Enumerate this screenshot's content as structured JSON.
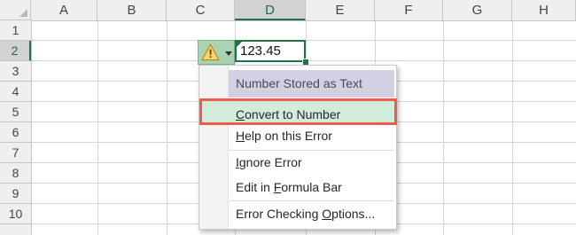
{
  "columns": [
    "A",
    "B",
    "C",
    "D",
    "E",
    "F",
    "G",
    "H"
  ],
  "rows": [
    "1",
    "2",
    "3",
    "4",
    "5",
    "6",
    "7",
    "8",
    "9",
    "10"
  ],
  "selected_column": "D",
  "selected_row": "2",
  "cell": {
    "value": "123.45"
  },
  "error_button": {
    "icon": "warning-icon"
  },
  "menu": {
    "header": "Number Stored as Text",
    "convert": {
      "pre": "",
      "key": "C",
      "post": "onvert to Number"
    },
    "help": {
      "pre": "",
      "key": "H",
      "post": "elp on this Error"
    },
    "ignore": {
      "pre": "",
      "key": "I",
      "post": "gnore Error"
    },
    "edit": {
      "pre": "Edit in ",
      "key": "F",
      "post": "ormula Bar"
    },
    "options": {
      "pre": "Error Checking ",
      "key": "O",
      "post": "ptions..."
    }
  },
  "colors": {
    "accent": "#217346",
    "highlight_border": "#ef5a4f",
    "highlight_fill": "#d2ecdc",
    "header_fill": "#d2d0e2"
  }
}
